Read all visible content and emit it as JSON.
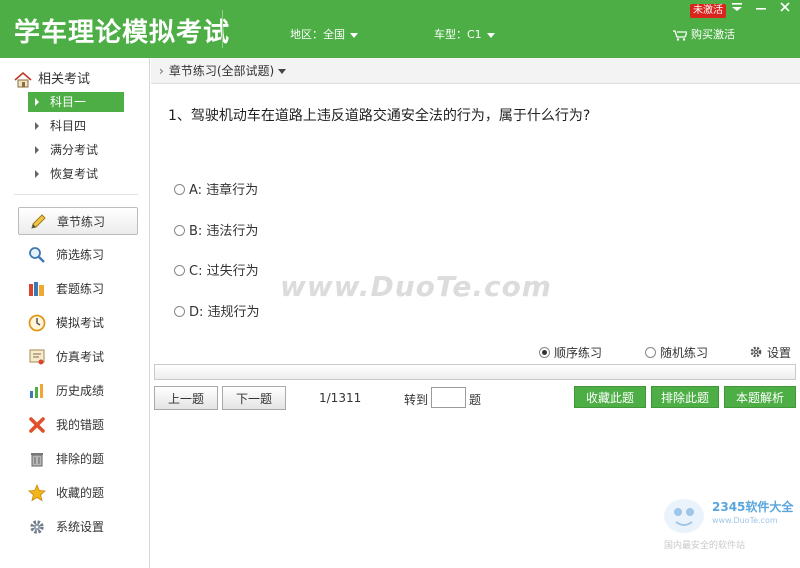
{
  "header": {
    "title": "学车理论模拟考试",
    "region_label": "地区：全国",
    "cartype_label": "车型：C1",
    "buy_label": "购买激活",
    "badge": "未激活",
    "accent_color": "#4cae45"
  },
  "sidebar": {
    "top_label": "相关考试",
    "sub_items": [
      {
        "label": "科目一",
        "active": true
      },
      {
        "label": "科目四",
        "active": false
      },
      {
        "label": "满分考试",
        "active": false
      },
      {
        "label": "恢复考试",
        "active": false
      }
    ],
    "menu": [
      {
        "label": "章节练习",
        "icon": "pencil-icon"
      },
      {
        "label": "筛选练习",
        "icon": "magnifier-icon"
      },
      {
        "label": "套题练习",
        "icon": "books-icon"
      },
      {
        "label": "模拟考试",
        "icon": "clock-icon"
      },
      {
        "label": "仿真考试",
        "icon": "certificate-icon"
      },
      {
        "label": "历史成绩",
        "icon": "bar-chart-icon"
      },
      {
        "label": "我的错题",
        "icon": "cross-icon"
      },
      {
        "label": "排除的题",
        "icon": "trash-icon"
      },
      {
        "label": "收藏的题",
        "icon": "star-icon"
      },
      {
        "label": "系统设置",
        "icon": "gear-icon"
      }
    ]
  },
  "breadcrumb": {
    "label": "章节练习(全部试题)"
  },
  "question": {
    "text": "1、驾驶机动车在道路上违反道路交通安全法的行为，属于什么行为?",
    "options": [
      "A: 违章行为",
      "B: 违法行为",
      "C: 过失行为",
      "D: 违规行为"
    ]
  },
  "watermark": "www.DuoTe.com",
  "mode": {
    "sequential": "顺序练习",
    "random": "随机练习",
    "settings": "设置"
  },
  "progress": {
    "value": 0
  },
  "nav": {
    "prev": "上一题",
    "next": "下一题",
    "counter": "1/1311",
    "goto_label": "转到",
    "goto_value": "",
    "goto_unit": "题",
    "favorite": "收藏此题",
    "exclude": "排除此题",
    "analysis": "本题解析"
  },
  "corner_logo": {
    "line1": "2345软件大全",
    "line2": "www.DuoTe.com",
    "line3": "国内最安全的软件站"
  }
}
